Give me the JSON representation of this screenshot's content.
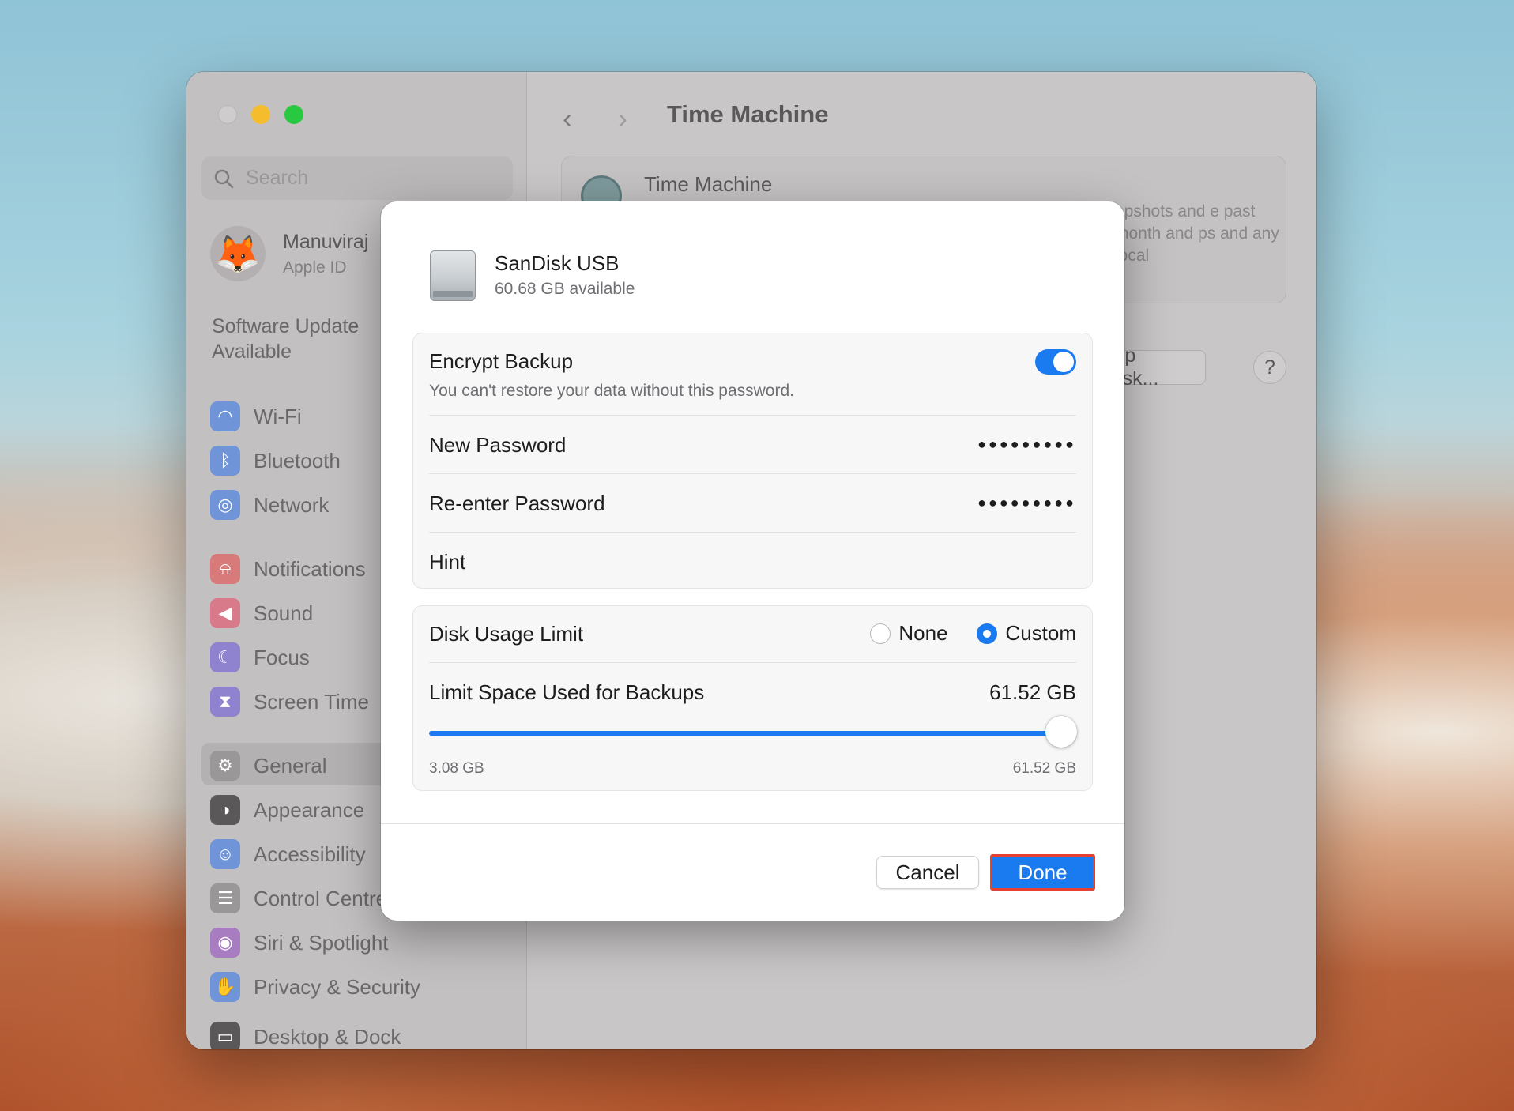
{
  "window": {
    "title": "Time Machine"
  },
  "sidebar": {
    "search_placeholder": "Search",
    "profile": {
      "name": "Manuviraj",
      "subtitle": "Apple ID"
    },
    "software_update": "Software Update Available",
    "items": [
      {
        "label": "Wi-Fi",
        "icon": "wifi-icon",
        "color": "#6f95d8"
      },
      {
        "label": "Bluetooth",
        "icon": "bluetooth-icon",
        "color": "#6f95d8"
      },
      {
        "label": "Network",
        "icon": "globe-icon",
        "color": "#6f95d8"
      },
      {
        "label": "Notifications",
        "icon": "bell-icon",
        "color": "#d97a7a"
      },
      {
        "label": "Sound",
        "icon": "speaker-icon",
        "color": "#d97a8a"
      },
      {
        "label": "Focus",
        "icon": "moon-icon",
        "color": "#8f82cf"
      },
      {
        "label": "Screen Time",
        "icon": "hourglass-icon",
        "color": "#8f82cf"
      },
      {
        "label": "General",
        "icon": "gear-icon",
        "color": "#9a9798"
      },
      {
        "label": "Appearance",
        "icon": "appearance-icon",
        "color": "#5a5859"
      },
      {
        "label": "Accessibility",
        "icon": "accessibility-icon",
        "color": "#6f95d8"
      },
      {
        "label": "Control Centre",
        "icon": "control-centre-icon",
        "color": "#9a9798"
      },
      {
        "label": "Siri & Spotlight",
        "icon": "siri-icon",
        "color": "#a77cc0"
      },
      {
        "label": "Privacy & Security",
        "icon": "hand-icon",
        "color": "#6f95d8"
      },
      {
        "label": "Desktop & Dock",
        "icon": "dock-icon",
        "color": "#5a5859"
      }
    ]
  },
  "content": {
    "card_title": "Time Machine",
    "card_desc": "apshots and e past month and ps and any local",
    "backup_disk_button": "kup Disk...",
    "help_button": "?"
  },
  "dialog": {
    "disk_name": "SanDisk USB",
    "disk_available": "60.68 GB available",
    "encrypt": {
      "label": "Encrypt Backup",
      "sublabel": "You can't restore your data without this password.",
      "enabled": true
    },
    "new_password": {
      "label": "New Password",
      "value": "●●●●●●●●●"
    },
    "reenter_password": {
      "label": "Re-enter Password",
      "value": "●●●●●●●●●"
    },
    "hint": {
      "label": "Hint",
      "value": ""
    },
    "disk_usage": {
      "label": "Disk Usage Limit",
      "option_none": "None",
      "option_custom": "Custom",
      "selected": "Custom"
    },
    "limit": {
      "label": "Limit Space Used for Backups",
      "value": "61.52 GB",
      "min_label": "3.08 GB",
      "max_label": "61.52 GB",
      "fraction": 1.0
    },
    "cancel_button": "Cancel",
    "done_button": "Done"
  },
  "colors": {
    "accent": "#1a7bf0",
    "highlight_border": "#e5432f"
  }
}
